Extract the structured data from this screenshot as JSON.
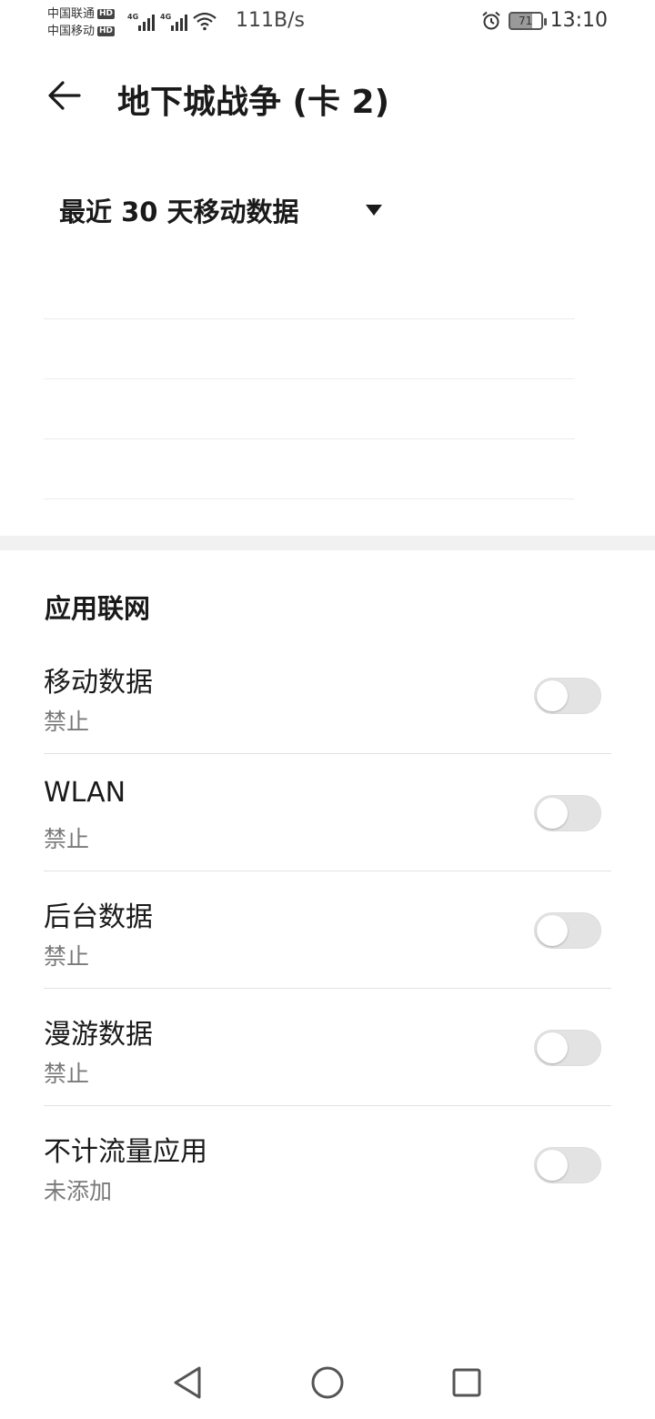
{
  "status_bar": {
    "carrier1": "中国联通",
    "carrier2": "中国移动",
    "hd_badge": "HD",
    "network_type": "4G",
    "net_speed": "111B/s",
    "battery_level": "71",
    "time": "13:10",
    "icons": [
      "signal-icon",
      "wifi-icon",
      "alarm-icon",
      "battery-icon"
    ]
  },
  "app_bar": {
    "title": "地下城战争 (卡 2)",
    "back_icon": "back-arrow-icon"
  },
  "period": {
    "label": "最近 30 天移动数据",
    "caret_icon": "dropdown-caret-icon"
  },
  "section": {
    "title": "应用联网"
  },
  "settings": [
    {
      "title": "移动数据",
      "subtitle": "禁止",
      "enabled": false
    },
    {
      "title": "WLAN",
      "subtitle": "禁止",
      "enabled": false
    },
    {
      "title": "后台数据",
      "subtitle": "禁止",
      "enabled": false
    },
    {
      "title": "漫游数据",
      "subtitle": "禁止",
      "enabled": false
    },
    {
      "title": "不计流量应用",
      "subtitle": "未添加",
      "enabled": false
    }
  ],
  "nav_bar": {
    "icons": [
      "back-triangle-icon",
      "home-circle-icon",
      "recents-square-icon"
    ]
  },
  "colors": {
    "text_primary": "#1a1a1a",
    "text_secondary": "#7a7a7a",
    "toggle_off": "#e3e3e3",
    "divider": "#e2e2e2"
  }
}
